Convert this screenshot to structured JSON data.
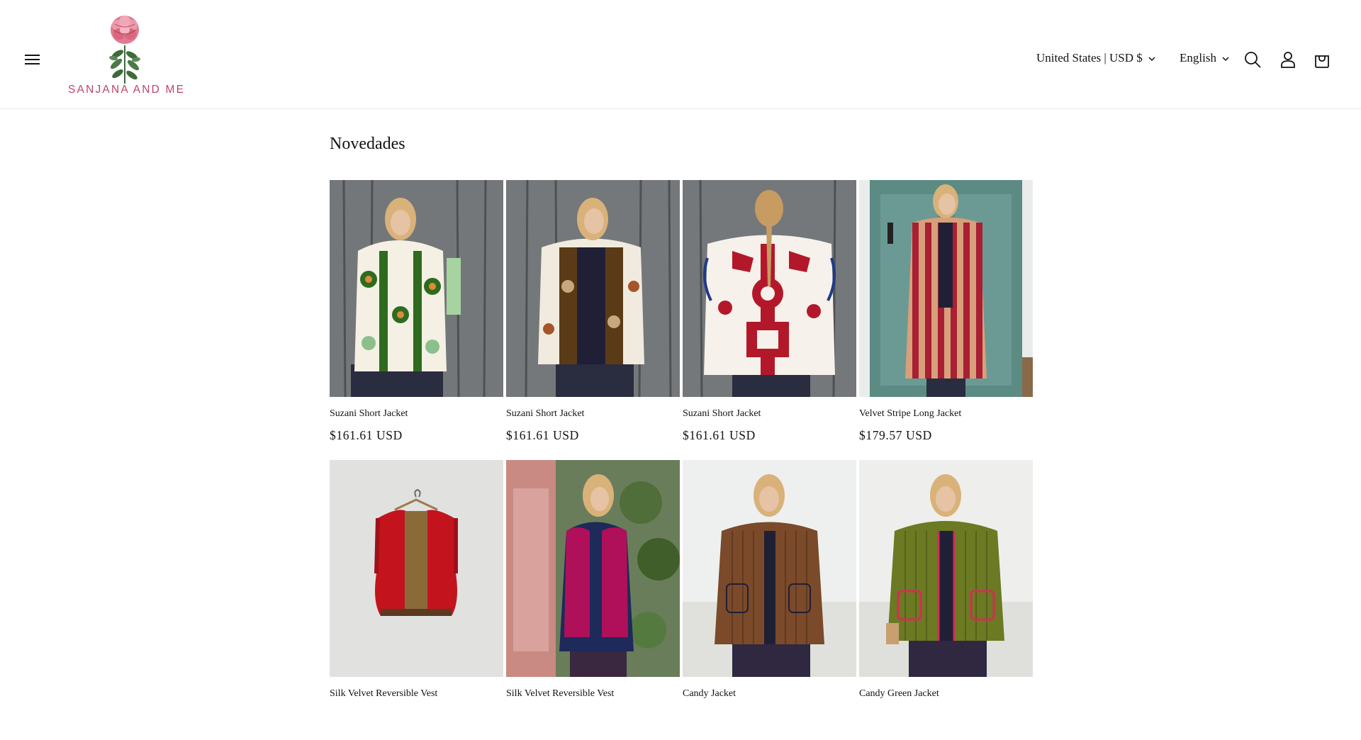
{
  "header": {
    "logo_text": "SANJANA AND ME",
    "country": "United States | USD $",
    "language": "English",
    "icons": {
      "menu": "hamburger-icon",
      "search": "search-icon",
      "account": "account-icon",
      "cart": "cart-icon"
    }
  },
  "section": {
    "title": "Novedades"
  },
  "products": [
    {
      "title": "Suzani Short Jacket",
      "price": "$161.61 USD"
    },
    {
      "title": "Suzani Short Jacket",
      "price": "$161.61 USD"
    },
    {
      "title": "Suzani Short Jacket",
      "price": "$161.61 USD"
    },
    {
      "title": "Velvet Stripe Long Jacket",
      "price": "$179.57 USD"
    },
    {
      "title": "Silk Velvet Reversible Vest",
      "price": ""
    },
    {
      "title": "Silk Velvet Reversible Vest",
      "price": ""
    },
    {
      "title": "Candy Jacket",
      "price": ""
    },
    {
      "title": "Candy Green Jacket",
      "price": ""
    }
  ],
  "colors": {
    "brand_pink": "#c0436a",
    "text": "#121212"
  }
}
